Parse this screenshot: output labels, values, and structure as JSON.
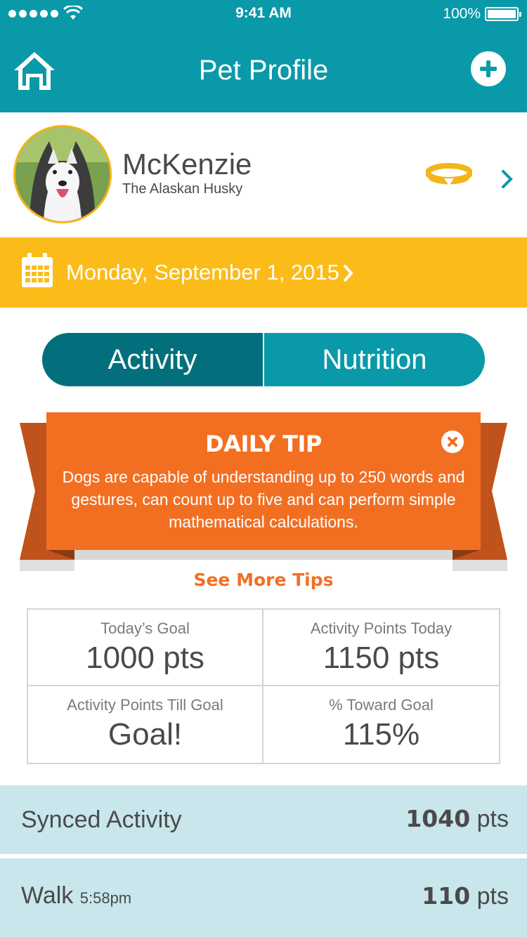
{
  "status_bar": {
    "time": "9:41 AM",
    "battery_percent": "100%",
    "signal_icon": "signal-dots-icon",
    "wifi_icon": "wifi-icon",
    "battery_level": 1.0
  },
  "nav": {
    "title": "Pet Profile",
    "home_icon": "home-icon",
    "add_icon": "plus-circle-icon"
  },
  "pet": {
    "name": "McKenzie",
    "breed": "The Alaskan Husky",
    "collar_icon": "collar-icon",
    "chevron_icon": "chevron-right-icon"
  },
  "date": {
    "label": "Monday, September 1, 2015",
    "calendar_icon": "calendar-icon"
  },
  "tabs": [
    {
      "label": "Activity",
      "active": true
    },
    {
      "label": "Nutrition",
      "active": false
    }
  ],
  "tip": {
    "title": "DAILY TIP",
    "body": "Dogs are capable of understanding up to 250 words and gestures, can count up to five and can perform simple mathematical calculations.",
    "close_icon": "close-icon",
    "see_more": "See More Tips"
  },
  "stats": [
    {
      "label": "Today’s Goal",
      "value": "1000 pts"
    },
    {
      "label": "Activity Points Today",
      "value": "1150 pts"
    },
    {
      "label": "Activity Points Till Goal",
      "value": "Goal!"
    },
    {
      "label": "% Toward Goal",
      "value": "115%"
    }
  ],
  "activities": [
    {
      "label": "Synced Activity",
      "time": "",
      "points": "1040",
      "unit": "pts"
    },
    {
      "label": "Walk",
      "time": "5:58pm",
      "points": "110",
      "unit": "pts"
    }
  ],
  "colors": {
    "teal": "#0a99a9",
    "teal_dark": "#036f7c",
    "yellow": "#fbbc19",
    "orange": "#f26f22",
    "row_bg": "#c8e6eb"
  }
}
